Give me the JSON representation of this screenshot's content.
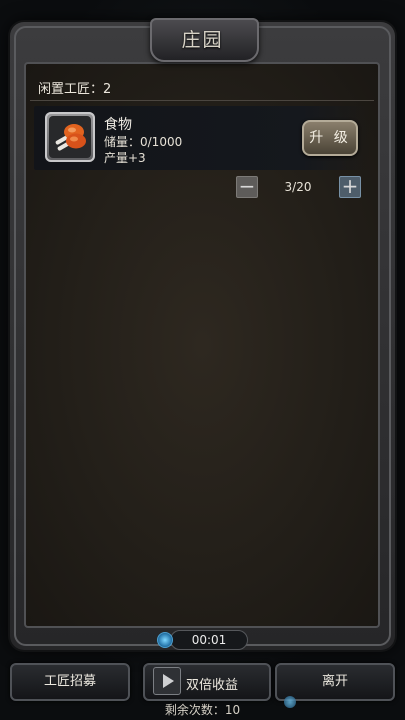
{
  "header": {
    "title": "庄园"
  },
  "workers": {
    "idle_label": "闲置工匠：2"
  },
  "resource": {
    "name": "食物",
    "stock": "储量：0/1000",
    "output": "产量+3",
    "upgrade_label": "升 级",
    "count": "3/20",
    "icon": "food-icon"
  },
  "timer": {
    "value": "00:01"
  },
  "footer": {
    "recruit_label": "工匠招募",
    "double_label": "双倍收益",
    "leave_label": "离开",
    "remaining": "剩余次数：10"
  },
  "colors": {
    "panel_bg": "#231f19",
    "frame": "#3c3c3e",
    "accent_blue": "#4c9fd0"
  }
}
